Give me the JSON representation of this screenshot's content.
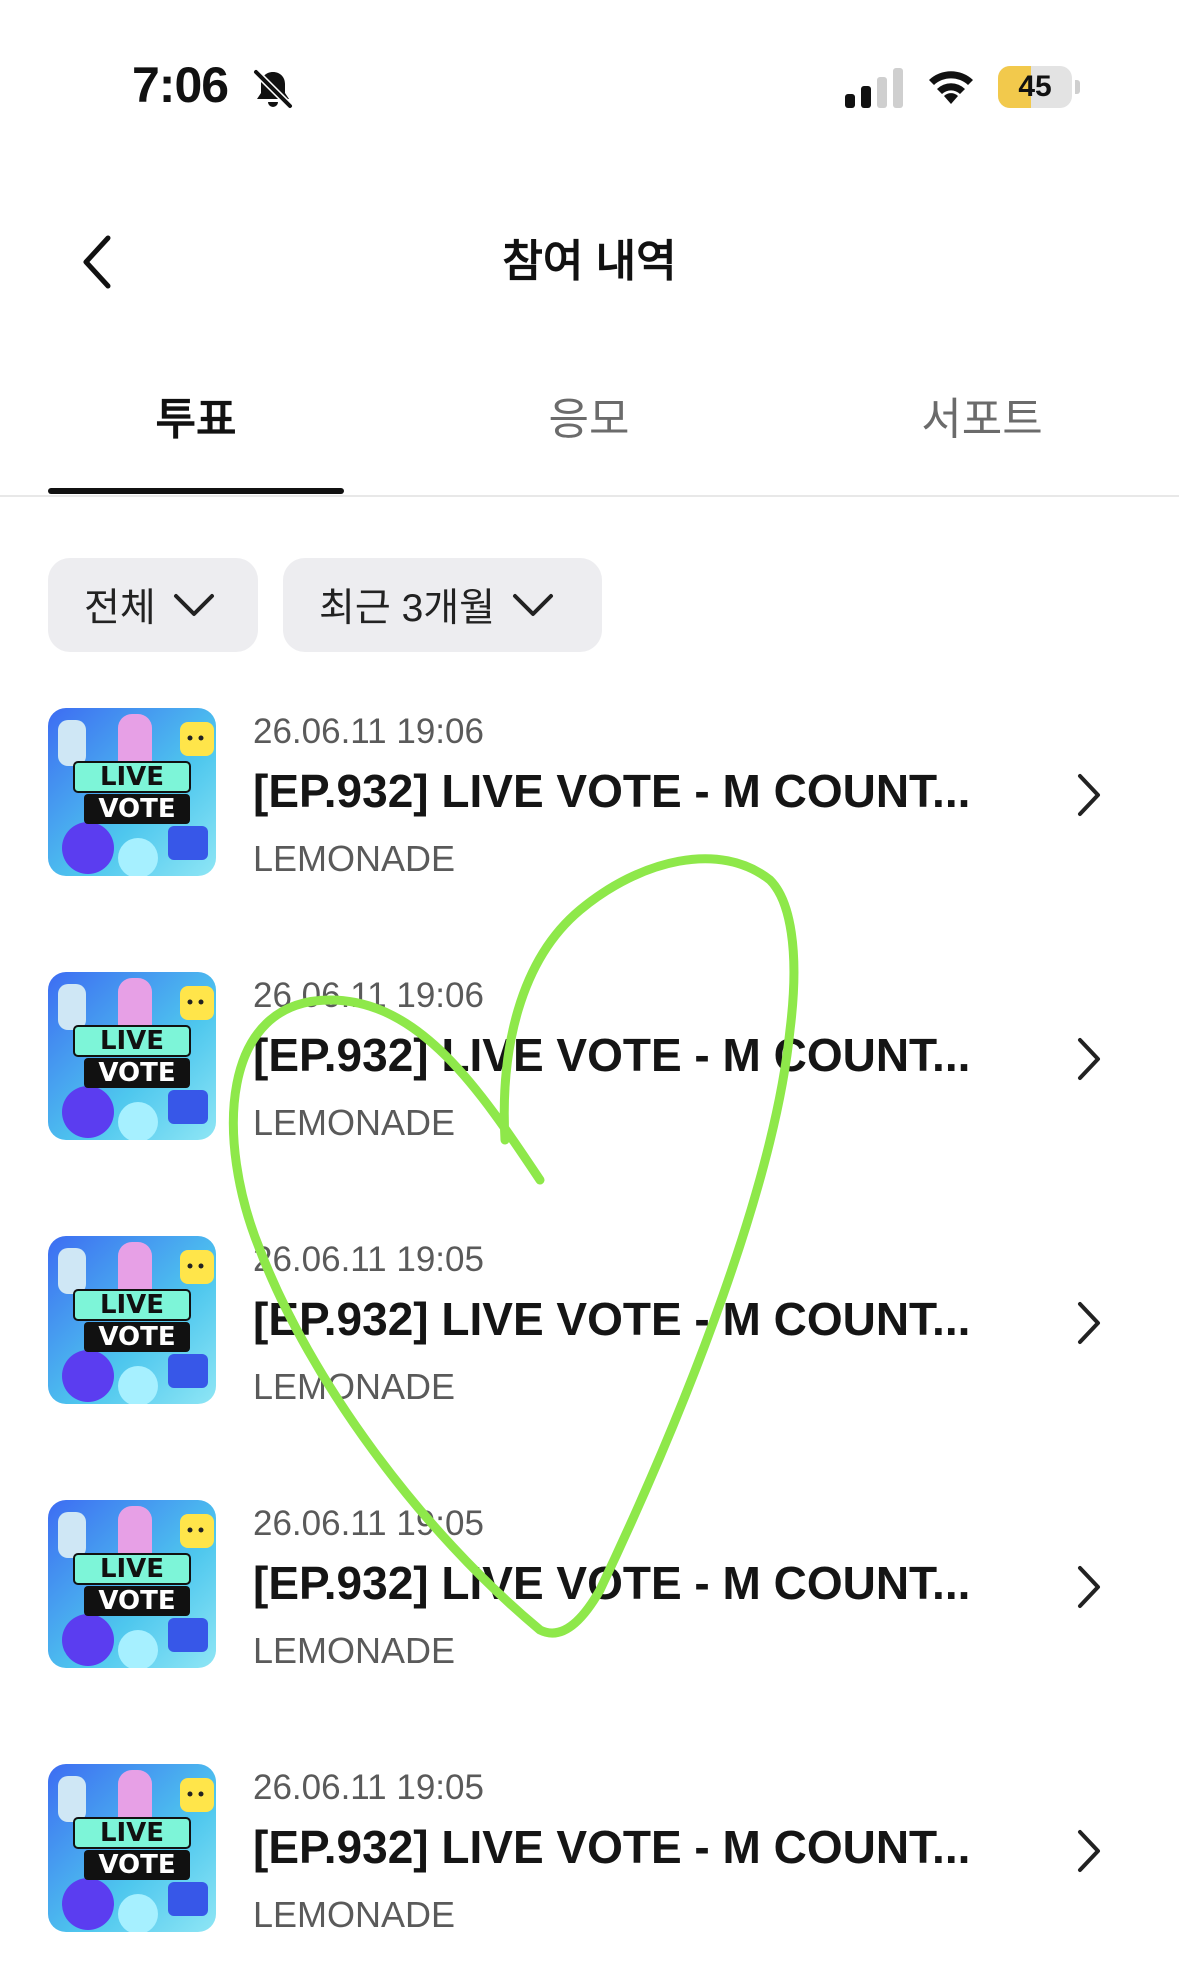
{
  "status_bar": {
    "time": "7:06",
    "battery": "45",
    "battery_level": 0.45
  },
  "header": {
    "title": "참여 내역"
  },
  "tabs": [
    {
      "label": "투표",
      "active": true
    },
    {
      "label": "응모",
      "active": false
    },
    {
      "label": "서포트",
      "active": false
    }
  ],
  "filters": {
    "category": "전체",
    "period": "최근 3개월"
  },
  "thumbnail": {
    "line1": "LIVE",
    "line2": "VOTE"
  },
  "items": [
    {
      "date": "26.06.11 19:06",
      "title": "[EP.932] LIVE VOTE - M COUNT...",
      "artist": "LEMONADE"
    },
    {
      "date": "26.06.11 19:06",
      "title": "[EP.932] LIVE VOTE - M COUNT...",
      "artist": "LEMONADE"
    },
    {
      "date": "26.06.11 19:05",
      "title": "[EP.932] LIVE VOTE - M COUNT...",
      "artist": "LEMONADE"
    },
    {
      "date": "26.06.11 19:05",
      "title": "[EP.932] LIVE VOTE - M COUNT...",
      "artist": "LEMONADE"
    },
    {
      "date": "26.06.11 19:05",
      "title": "[EP.932] LIVE VOTE - M COUNT...",
      "artist": "LEMONADE"
    }
  ],
  "icons": {
    "back": "chevron-left-icon",
    "row": "chevron-right-icon",
    "dropdown": "chevron-down-icon",
    "bell": "bell-slash-icon"
  },
  "colors": {
    "accent_heart": "#8ee84a",
    "battery": "#f2c94c"
  }
}
